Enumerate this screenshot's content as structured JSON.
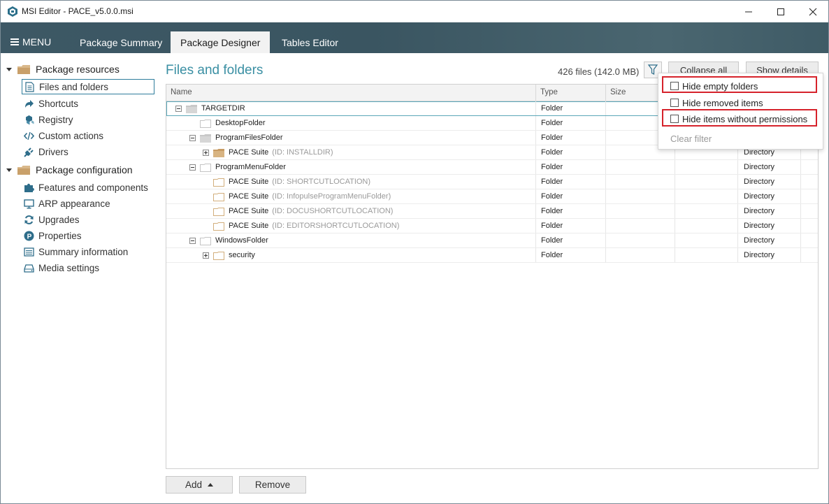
{
  "window": {
    "title": "MSI Editor - PACE_v5.0.0.msi"
  },
  "menubar": {
    "menu_label": "MENU",
    "tabs": [
      {
        "label": "Package Summary"
      },
      {
        "label": "Package Designer"
      },
      {
        "label": "Tables Editor"
      }
    ]
  },
  "sidebar": {
    "groups": [
      {
        "label": "Package resources",
        "items": [
          {
            "label": "Files and folders",
            "icon": "files-icon"
          },
          {
            "label": "Shortcuts",
            "icon": "shortcut-icon"
          },
          {
            "label": "Registry",
            "icon": "registry-icon"
          },
          {
            "label": "Custom actions",
            "icon": "code-icon"
          },
          {
            "label": "Drivers",
            "icon": "plug-icon"
          }
        ]
      },
      {
        "label": "Package configuration",
        "items": [
          {
            "label": "Features and components",
            "icon": "puzzle-icon"
          },
          {
            "label": "ARP appearance",
            "icon": "monitor-icon"
          },
          {
            "label": "Upgrades",
            "icon": "refresh-icon"
          },
          {
            "label": "Properties",
            "icon": "properties-icon"
          },
          {
            "label": "Summary information",
            "icon": "list-icon"
          },
          {
            "label": "Media settings",
            "icon": "drive-icon"
          }
        ]
      }
    ]
  },
  "main": {
    "title": "Files and folders",
    "count": "426 files (142.0 MB)",
    "collapse_label": "Collapse all",
    "details_label": "Show details",
    "columns": [
      "Name",
      "Type",
      "Size"
    ],
    "rows": [
      {
        "name": "TARGETDIR",
        "id": "",
        "type": "Folder",
        "extra": "",
        "expander": "minus",
        "folder": "grey"
      },
      {
        "name": "DesktopFolder",
        "id": "",
        "type": "Folder",
        "extra": "",
        "expander": "",
        "folder": "white"
      },
      {
        "name": "ProgramFilesFolder",
        "id": "",
        "type": "Folder",
        "extra": "",
        "expander": "minus",
        "folder": "grey"
      },
      {
        "name": "PACE Suite",
        "id": "(ID: INSTALLDIR)",
        "type": "Folder",
        "extra": "Directory",
        "expander": "plus",
        "folder": "tan"
      },
      {
        "name": "ProgramMenuFolder",
        "id": "",
        "type": "Folder",
        "extra": "Directory",
        "expander": "minus",
        "folder": "white"
      },
      {
        "name": "PACE Suite",
        "id": "(ID: SHORTCUTLOCATION)",
        "type": "Folder",
        "extra": "Directory",
        "expander": "",
        "folder": "white-tan"
      },
      {
        "name": "PACE Suite",
        "id": "(ID: InfopulseProgramMenuFolder)",
        "type": "Folder",
        "extra": "Directory",
        "expander": "",
        "folder": "white-tan"
      },
      {
        "name": "PACE Suite",
        "id": "(ID: DOCUSHORTCUTLOCATION)",
        "type": "Folder",
        "extra": "Directory",
        "expander": "",
        "folder": "white-tan"
      },
      {
        "name": "PACE Suite",
        "id": "(ID: EDITORSHORTCUTLOCATION)",
        "type": "Folder",
        "extra": "Directory",
        "expander": "",
        "folder": "white-tan"
      },
      {
        "name": "WindowsFolder",
        "id": "",
        "type": "Folder",
        "extra": "Directory",
        "expander": "minus",
        "folder": "white"
      },
      {
        "name": "security",
        "id": "",
        "type": "Folder",
        "extra": "Directory",
        "expander": "plus",
        "folder": "white-tan"
      }
    ]
  },
  "filter_menu": {
    "options": [
      {
        "label": "Hide empty folders",
        "checked": false
      },
      {
        "label": "Hide removed items",
        "checked": false
      },
      {
        "label": "Hide items without permissions",
        "checked": false
      }
    ],
    "clear_label": "Clear filter"
  },
  "footer": {
    "add_label": "Add",
    "remove_label": "Remove"
  },
  "colors": {
    "accent": "#3a8fa3",
    "menubar": "#3d5865",
    "highlight": "#d6222b"
  }
}
